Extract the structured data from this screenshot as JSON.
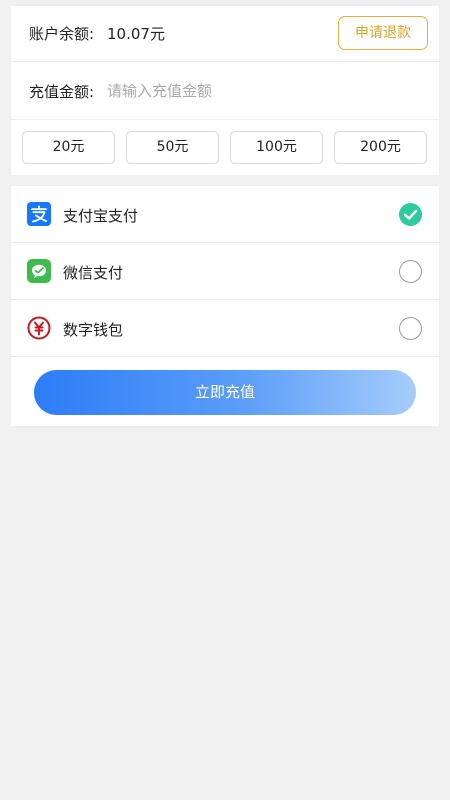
{
  "balance": {
    "label": "账户余额:",
    "value": "10.07元",
    "refund_label": "申请退款"
  },
  "amount": {
    "label": "充值金额:",
    "placeholder": "请输入充值金额",
    "value": ""
  },
  "presets": [
    "20元",
    "50元",
    "100元",
    "200元"
  ],
  "payment_methods": [
    {
      "label": "支付宝支付",
      "icon": "alipay-icon",
      "selected": true,
      "color": "#1677ff"
    },
    {
      "label": "微信支付",
      "icon": "wechat-pay-icon",
      "selected": false,
      "color": "#3dbb4d"
    },
    {
      "label": "数字钱包",
      "icon": "digital-wallet-icon",
      "selected": false,
      "color": "#c8161d"
    }
  ],
  "submit_label": "立即充值",
  "colors": {
    "accent": "#2d7cf7",
    "refund": "#d9a32a",
    "check": "#2ecc9a"
  }
}
